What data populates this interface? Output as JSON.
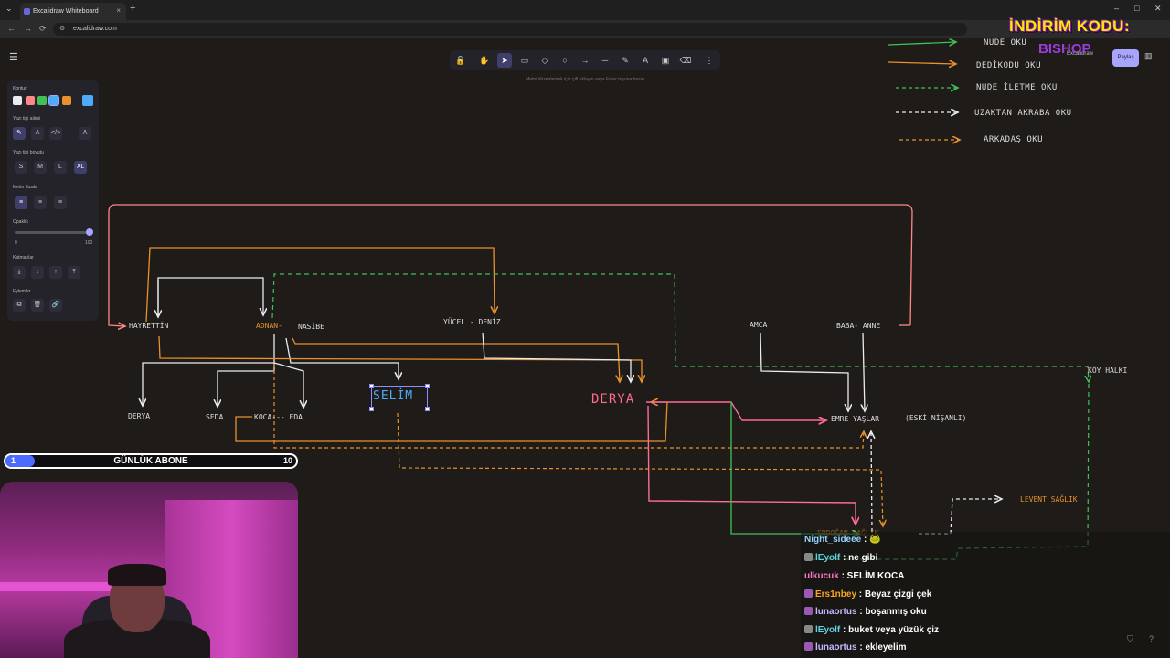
{
  "browser": {
    "tab_title": "Excalidraw Whiteboard",
    "url": "excalidraw.com",
    "new_tab": "+",
    "tab_close": "×",
    "min": "–",
    "max": "□",
    "close": "✕",
    "back": "←",
    "forward": "→",
    "reload": "⟳"
  },
  "toolbar": {
    "tools": [
      "lock-icon",
      "hand-icon",
      "selection-icon",
      "rectangle-icon",
      "diamond-icon",
      "ellipse-icon",
      "arrow-icon",
      "line-icon",
      "pencil-icon",
      "text-icon",
      "image-icon",
      "eraser-icon",
      "more-icon"
    ],
    "glyphs": [
      "🔓",
      "✋",
      "➤",
      "▭",
      "◇",
      "○",
      "→",
      "─",
      "✎",
      "A",
      "▣",
      "⌫",
      "⋮"
    ],
    "hint": "Metni düzenlemek için çift tıklayın veya Enter tuşuna basın"
  },
  "panel": {
    "kontur": "Kontur",
    "stroke_colors": [
      "#e9ecef",
      "#ff8787",
      "#40c057",
      "#4dabf7",
      "#e8912d"
    ],
    "stroke_selected": "#4dabf7",
    "font_family_label": "Yazı tipi ailesi",
    "font_family_glyphs": [
      "✎",
      "A",
      "</>",
      "A"
    ],
    "font_size_label": "Yazı tipi boyutu",
    "sizes": [
      "S",
      "M",
      "L",
      "XL"
    ],
    "align_label": "Metin hizala",
    "align_glyphs": [
      "≡",
      "≡",
      "≡"
    ],
    "opacity_label": "Opaklık",
    "opacity_min": "0",
    "opacity_max": "100",
    "layers_label": "Katmanlar",
    "layer_glyphs": [
      "⤓",
      "↓",
      "↑",
      "⤒"
    ],
    "actions_label": "Eylemler",
    "action_glyphs": [
      "⧉",
      "🗑",
      "🔗"
    ]
  },
  "header_right": {
    "library": "Excalidraw",
    "share": "Paylaş",
    "side": "▥"
  },
  "promo": {
    "code_label": "İNDİRİM KODU:",
    "code": "BISHOP"
  },
  "legend": [
    {
      "label": "NUDE OKU",
      "color": "#40c057"
    },
    {
      "label": "DEDİKODU OKU",
      "color": "#e8912d"
    },
    {
      "label": "NUDE İLETME OKU",
      "color": "#40c057"
    },
    {
      "label": "UZAKTAN AKRABA OKU",
      "color": "#ffffff"
    },
    {
      "label": "ARKADAŞ OKU",
      "color": "#e8912d"
    }
  ],
  "nodes": {
    "hayrettin": "HAYRETTİN",
    "adnan": "ADNAN-",
    "nasibe": "NASİBE",
    "yucel_deniz": "YÜCEL - DENİZ",
    "amca": "AMCA",
    "baba_anne": "BABA- ANNE",
    "koy_halki": "KÖY HALKI",
    "derya_small": "DERYA",
    "seda": "SEDA",
    "koca_eda": "KOCA--- EDA",
    "selim": "SELİM",
    "derya_big": "DERYA",
    "emre": "EMRE YAŞLAR",
    "eski_nisanli": "(ESKİ NİŞANLI)",
    "levent": "LEVENT SAĞLIK",
    "erdogan": "ERDOĞAN SAĞLIK"
  },
  "progress": {
    "label": "GÜNLÜK ABONE",
    "current": "1",
    "goal": "10",
    "fraction": 0.1
  },
  "chat": [
    {
      "user": "Night_sideee",
      "text": " : 🐸",
      "color": "#8fd3ff",
      "badge": ""
    },
    {
      "user": "lEyolf",
      "text": " : ne gibi",
      "color": "#5fd3e0",
      "badge": "#888888"
    },
    {
      "user": "ulkucuk",
      "text": " : SELİM KOCA",
      "color": "#ff77c8",
      "badge": ""
    },
    {
      "user": "Ers1nbey",
      "text": " : Beyaz çizgi çek",
      "color": "#f5a623",
      "badge": "#9b59b6"
    },
    {
      "user": "lunaortus",
      "text": " : boşanmış oku",
      "color": "#c9b8ff",
      "badge": "#9b59b6"
    },
    {
      "user": "lEyolf",
      "text": " : buket veya yüzük çiz",
      "color": "#5fd3e0",
      "badge": "#888888"
    },
    {
      "user": "lunaortus",
      "text": " : ekleyelim",
      "color": "#c9b8ff",
      "badge": "#9b59b6"
    }
  ]
}
